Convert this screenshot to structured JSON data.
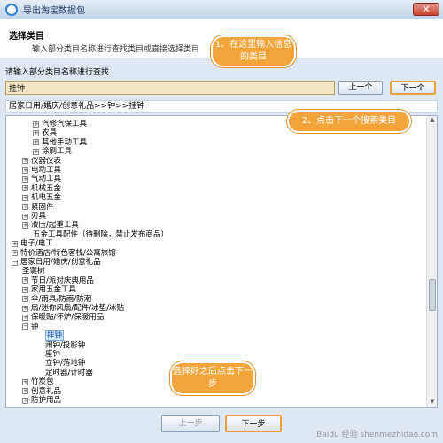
{
  "window": {
    "title": "导出淘宝数据包",
    "close_symbol": "✕"
  },
  "header": {
    "title": "选择类目",
    "description": "输入部分类目名称进行查找类目或直接选择类目"
  },
  "search": {
    "prompt": "请输入部分类目名称进行查找",
    "value": "挂钟"
  },
  "buttons": {
    "prev_match": "上一个",
    "next_match": "下一个",
    "back": "上一步",
    "next": "下一步"
  },
  "path": "居家日用/婚庆/创意礼品>>钟>>挂钟",
  "tree": [
    {
      "label": "汽修汽保工具",
      "exp": "+"
    },
    {
      "label": "农具",
      "exp": "+"
    },
    {
      "label": "其他手动工具",
      "exp": "+"
    },
    {
      "label": "涂刷工具",
      "exp": "+"
    },
    {
      "label": "仪器仪表",
      "exp": "+"
    },
    {
      "label": "电动工具",
      "exp": "+"
    },
    {
      "label": "气动工具",
      "exp": "+"
    },
    {
      "label": "机械五金",
      "exp": "+"
    },
    {
      "label": "机电五金",
      "exp": "+"
    },
    {
      "label": "紧固件",
      "exp": "+"
    },
    {
      "label": "刃具",
      "exp": "+"
    },
    {
      "label": "液压/起重工具",
      "exp": "+"
    },
    {
      "label": "五金工具配件（待删除，禁止发布商品）",
      "exp": ""
    },
    {
      "label": "电子/电工",
      "exp": "+"
    },
    {
      "label": "特价酒店/特色客栈/公寓旅馆",
      "exp": "+"
    },
    {
      "label": "居家日用/婚庆/创意礼品",
      "exp": "−"
    },
    {
      "label": "圣诞树",
      "exp": ""
    },
    {
      "label": "节日/派对庆典用品",
      "exp": "+"
    },
    {
      "label": "家用五金工具",
      "exp": "+"
    },
    {
      "label": "伞/雨具/防雨/防潮",
      "exp": "+"
    },
    {
      "label": "扇/迷你风扇/配件/冰垫/冰贴",
      "exp": "+"
    },
    {
      "label": "保暖贴/怀炉/保暖用品",
      "exp": "+"
    },
    {
      "label": "钟",
      "exp": "−"
    },
    {
      "label": "挂钟",
      "exp": "",
      "selected": true
    },
    {
      "label": "闹钟/投影钟",
      "exp": ""
    },
    {
      "label": "座钟",
      "exp": ""
    },
    {
      "label": "立钟/落地钟",
      "exp": ""
    },
    {
      "label": "定时器/计时器",
      "exp": ""
    },
    {
      "label": "竹炭包",
      "exp": "+"
    },
    {
      "label": "创意礼品",
      "exp": "+"
    },
    {
      "label": "防护用品",
      "exp": "+"
    }
  ],
  "annotations": {
    "b1": "1、在这里输入信息的类目",
    "b2": "2、点击下一个搜索类目",
    "b3": "选择好之后点击下一步"
  },
  "watermark": "Baidu 经验 shenmezhidao.com"
}
